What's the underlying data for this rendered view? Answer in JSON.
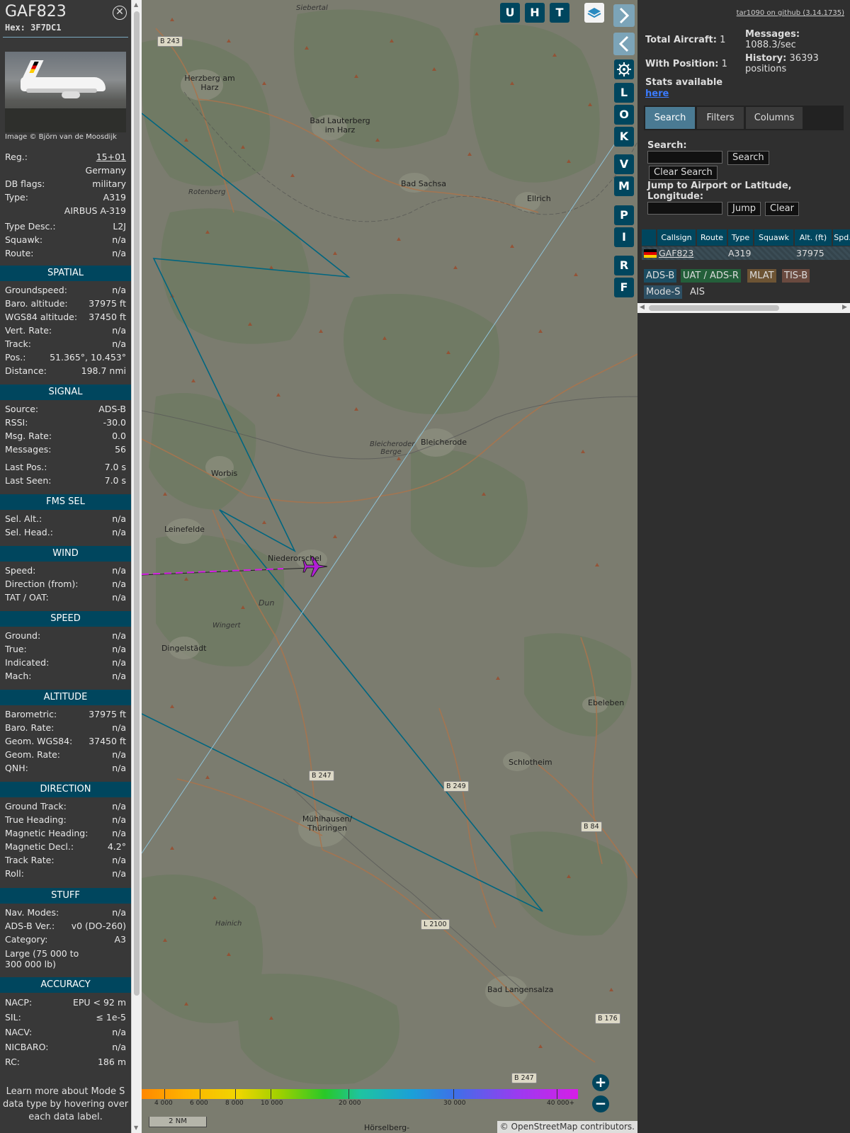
{
  "info": {
    "callsign": "GAF823",
    "hex_label": "Hex: 3F7DC1",
    "close_icon": "close-circle-icon",
    "photo_credit": "Image © Björn van de Moosdijk",
    "registration": {
      "label": "Reg.:",
      "value": "15+01"
    },
    "country": "Germany",
    "db_flags": {
      "label": "DB flags:",
      "value": "military"
    },
    "type": {
      "label": "Type:",
      "value": "A319"
    },
    "type_name": "AIRBUS A-319",
    "type_desc": {
      "label": "Type Desc.:",
      "value": "L2J"
    },
    "squawk": {
      "label": "Squawk:",
      "value": "n/a"
    },
    "route": {
      "label": "Route:",
      "value": "n/a"
    },
    "sections": {
      "spatial": "SPATIAL",
      "signal": "SIGNAL",
      "fms": "FMS SEL",
      "wind": "WIND",
      "speed": "SPEED",
      "altitude": "ALTITUDE",
      "direction": "DIRECTION",
      "stuff": "STUFF",
      "accuracy": "ACCURACY"
    },
    "spatial": [
      {
        "label": "Groundspeed:",
        "value": "n/a"
      },
      {
        "label": "Baro. altitude:",
        "value": "37975 ft"
      },
      {
        "label": "WGS84 altitude:",
        "value": "37450 ft"
      },
      {
        "label": "Vert. Rate:",
        "value": "n/a"
      },
      {
        "label": "Track:",
        "value": "n/a"
      },
      {
        "label": "Pos.:",
        "value": "51.365°, 10.453°"
      },
      {
        "label": "Distance:",
        "value": "198.7 nmi"
      }
    ],
    "signal": [
      {
        "label": "Source:",
        "value": "ADS-B"
      },
      {
        "label": "RSSI:",
        "value": "-30.0"
      },
      {
        "label": "Msg. Rate:",
        "value": "0.0"
      },
      {
        "label": "Messages:",
        "value": "56"
      },
      {
        "label": "Last Pos.:",
        "value": "7.0 s"
      },
      {
        "label": "Last Seen:",
        "value": "7.0 s"
      }
    ],
    "fms": [
      {
        "label": "Sel. Alt.:",
        "value": "n/a"
      },
      {
        "label": "Sel. Head.:",
        "value": "n/a"
      }
    ],
    "wind": [
      {
        "label": "Speed:",
        "value": "n/a"
      },
      {
        "label": "Direction (from):",
        "value": "n/a"
      },
      {
        "label": "TAT / OAT:",
        "value": "n/a"
      }
    ],
    "speed": [
      {
        "label": "Ground:",
        "value": "n/a"
      },
      {
        "label": "True:",
        "value": "n/a"
      },
      {
        "label": "Indicated:",
        "value": "n/a"
      },
      {
        "label": "Mach:",
        "value": "n/a"
      }
    ],
    "altitude": [
      {
        "label": "Barometric:",
        "value": "37975 ft"
      },
      {
        "label": "Baro. Rate:",
        "value": "n/a"
      },
      {
        "label": "Geom. WGS84:",
        "value": "37450 ft"
      },
      {
        "label": "Geom. Rate:",
        "value": "n/a"
      },
      {
        "label": "QNH:",
        "value": "n/a"
      }
    ],
    "direction": [
      {
        "label": "Ground Track:",
        "value": "n/a"
      },
      {
        "label": "True Heading:",
        "value": "n/a"
      },
      {
        "label": "Magnetic Heading:",
        "value": "n/a"
      },
      {
        "label": "Magnetic Decl.:",
        "value": "4.2°"
      },
      {
        "label": "Track Rate:",
        "value": "n/a"
      },
      {
        "label": "Roll:",
        "value": "n/a"
      }
    ],
    "stuff": [
      {
        "label": "Nav. Modes:",
        "value": "n/a"
      },
      {
        "label": "ADS-B Ver.:",
        "value": "v0 (DO-260)"
      },
      {
        "label": "Category:",
        "value": "A3"
      }
    ],
    "category_desc": "Large (75 000 to 300 000 lb)",
    "accuracy": [
      {
        "label": "NACP:",
        "value": "EPU < 92 m"
      },
      {
        "label": "SIL:",
        "value": "≤ 1e-5"
      },
      {
        "label": "NACV:",
        "value": "n/a"
      },
      {
        "label": "NICBARO:",
        "value": "n/a"
      },
      {
        "label": "RC:",
        "value": "186 m"
      }
    ],
    "footer_note": "Learn more about Mode S data type by hovering over each data label."
  },
  "map": {
    "labels": {
      "siebertal": "Siebertal",
      "herzberg": "Herzberg am Harz",
      "bad_lauterberg": "Bad Lauterberg im Harz",
      "rotenberg": "Rotenberg",
      "bad_sachsa": "Bad Sachsa",
      "ellrich": "Ellrich",
      "bleicherode": "Bleicherode",
      "bleicheroder_berge": "Bleicheroder Berge",
      "worbis": "Worbis",
      "leinefelde": "Leinefelde",
      "niederorschel": "Niederorschel",
      "dun": "Dun",
      "wingert": "Wingert",
      "dingelstaedt": "Dingelstädt",
      "ebeleben": "Ebeleben",
      "schlotheim": "Schlotheim",
      "muehlhausen": "Mühlhausen/ Thüringen",
      "hainich": "Hainich",
      "bad_langensalza": "Bad Langensalza",
      "hoerselberg": "Hörselberg-"
    },
    "road_signs": {
      "b243": "B 243",
      "b247a": "B 247",
      "b249": "B 249",
      "b84": "B 84",
      "l2100": "L 2100",
      "b176": "B 176",
      "b247b": "B 247"
    },
    "toolbar": {
      "u": "U",
      "h": "H",
      "t": "T",
      "l": "L",
      "o": "O",
      "k": "K",
      "v": "V",
      "m": "M",
      "p": "P",
      "i": "I",
      "r": "R",
      "f": "F"
    },
    "legend_ticks": [
      "4 000",
      "6 000",
      "8 000",
      "10 000",
      "20 000",
      "30 000",
      "40 000+"
    ],
    "scale": "2 NM",
    "attribution": "© OpenStreetMap contributors.",
    "aircraft_color": "#b21ed6",
    "track_color": "#006680"
  },
  "sidebar": {
    "github": "tar1090 on github (3.14.1735)",
    "total_aircraft": {
      "label": "Total Aircraft:",
      "value": "1"
    },
    "with_position": {
      "label": "With Position:",
      "value": "1"
    },
    "messages": {
      "label": "Messages:",
      "value": "1088.3/sec"
    },
    "history": {
      "label": "History:",
      "value": "36393 positions"
    },
    "stats_text": "Stats available",
    "stats_link": "here",
    "tabs": [
      "Search",
      "Filters",
      "Columns"
    ],
    "search_label": "Search:",
    "search_button": "Search",
    "clear_search_button": "Clear Search",
    "jump_label": "Jump to Airport or Latitude, Longitude:",
    "jump_button": "Jump",
    "clear_button": "Clear",
    "columns": [
      "Callsign",
      "Route",
      "Type",
      "Squawk",
      "Alt. (ft)",
      "Spd."
    ],
    "rows": [
      {
        "callsign": "GAF823",
        "route": "",
        "type": "A319",
        "squawk": "",
        "alt": "37975",
        "spd": ""
      }
    ],
    "sources": [
      {
        "label": "ADS-B",
        "color": "#1c4e63"
      },
      {
        "label": "UAT / ADS-R",
        "color": "#245f3a"
      },
      {
        "label": "MLAT",
        "color": "#6d5434"
      },
      {
        "label": "TIS-B",
        "color": "#6a4a3f"
      },
      {
        "label": "Mode-S",
        "color": "#2d4f63"
      },
      {
        "label": "AIS",
        "color": "#2f2f2f"
      }
    ]
  }
}
